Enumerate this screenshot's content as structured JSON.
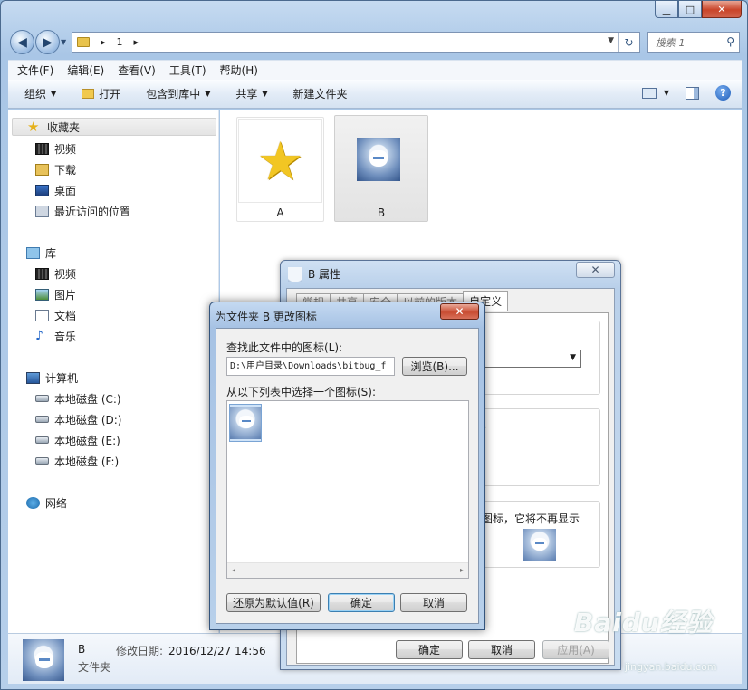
{
  "window": {
    "min_label": "▁",
    "max_label": "□",
    "close_label": "✕"
  },
  "address": {
    "crumb_sep1": "▸",
    "crumb": "1",
    "crumb_sep2": "▸",
    "dropdown": "▼",
    "refresh": "↻"
  },
  "search": {
    "placeholder": "搜索 1",
    "icon": "search-icon"
  },
  "menu": [
    "文件(F)",
    "编辑(E)",
    "查看(V)",
    "工具(T)",
    "帮助(H)"
  ],
  "commands": {
    "organize": "组织",
    "open": "打开",
    "include": "包含到库中",
    "share": "共享",
    "new_folder": "新建文件夹",
    "help": "?"
  },
  "navpane": {
    "favorites": "收藏夹",
    "fav_items": [
      "视频",
      "下载",
      "桌面",
      "最近访问的位置"
    ],
    "libraries": "库",
    "lib_items": [
      "视频",
      "图片",
      "文档",
      "音乐"
    ],
    "computer": "计算机",
    "drives": [
      "本地磁盘 (C:)",
      "本地磁盘 (D:)",
      "本地磁盘 (E:)",
      "本地磁盘 (F:)"
    ],
    "network": "网络"
  },
  "files": [
    {
      "name": "A",
      "icon": "star-icon"
    },
    {
      "name": "B",
      "icon": "anime-folder-icon"
    }
  ],
  "details": {
    "name": "B",
    "type": "文件夹",
    "modified_label": "修改日期:",
    "modified_value": "2016/12/27 14:56"
  },
  "properties_dialog": {
    "title": "B 属性",
    "close": "✕",
    "tabs": [
      "常规",
      "共享",
      "安全",
      "以前的版本",
      "自定义"
    ],
    "active_tab": "自定义",
    "text_fragment_1": "。",
    "text_fragment_2": "图标，它将不再显示",
    "ok": "确定",
    "cancel": "取消",
    "apply": "应用(A)"
  },
  "change_icon_dialog": {
    "title": "为文件夹 B 更改图标",
    "close": "✕",
    "find_label": "查找此文件中的图标(L):",
    "path": "D:\\用户目录\\Downloads\\bitbug_f",
    "browse": "浏览(B)...",
    "select_label": "从以下列表中选择一个图标(S):",
    "scroll_left": "◂",
    "scroll_right": "▸",
    "restore": "还原为默认值(R)",
    "ok": "确定",
    "cancel": "取消"
  },
  "watermark": {
    "brand": "Baidu经验",
    "url": "jingyan.baidu.com"
  }
}
